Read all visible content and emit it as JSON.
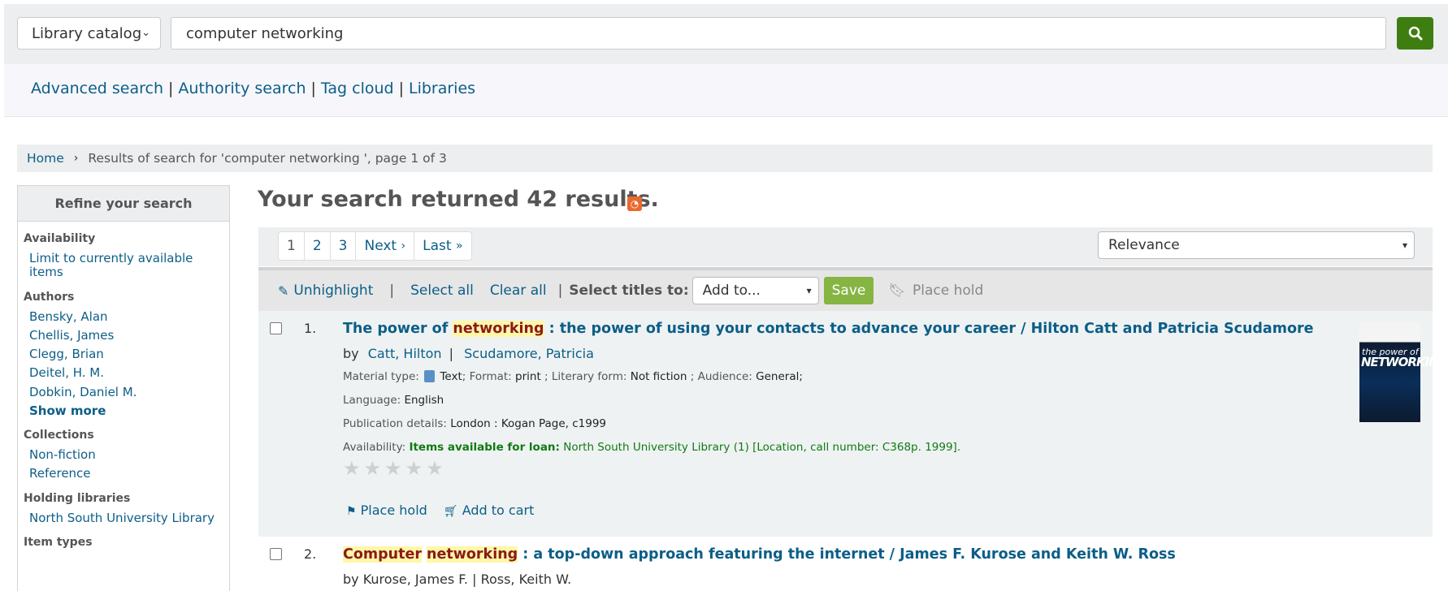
{
  "search": {
    "catalog_select": "Library catalog",
    "query": "computer networking"
  },
  "nav": {
    "links": [
      "Advanced search",
      "Authority search",
      "Tag cloud",
      "Libraries"
    ]
  },
  "breadcrumb": {
    "home": "Home",
    "current": "Results of search for 'computer networking ', page 1 of 3"
  },
  "refine": {
    "title": "Refine your search",
    "availability_label": "Availability",
    "availability_link": "Limit to currently available items",
    "authors_label": "Authors",
    "authors": [
      "Bensky, Alan",
      "Chellis, James",
      "Clegg, Brian",
      "Deitel, H. M.",
      "Dobkin, Daniel M."
    ],
    "show_more": "Show more",
    "collections_label": "Collections",
    "collections": [
      "Non-fiction",
      "Reference"
    ],
    "holding_label": "Holding libraries",
    "holding": [
      "North South University Library"
    ],
    "item_types_label": "Item types"
  },
  "results": {
    "heading": "Your search returned 42 results.",
    "pages": [
      "1",
      "2",
      "3"
    ],
    "next": "Next",
    "last": "Last",
    "sort": "Relevance"
  },
  "toolbar": {
    "unhighlight": "Unhighlight",
    "sep1": "|",
    "select_all": "Select all",
    "clear_all": "Clear all",
    "sep2": "|",
    "select_titles": "Select titles to:",
    "add_to": "Add to...",
    "save": "Save",
    "place_hold": "Place hold"
  },
  "result1": {
    "number": "1.",
    "title_pre": "The power of ",
    "title_hl": "networking",
    "title_post": " : the power of using your contacts to advance your career / Hilton Catt and Patricia Scudamore",
    "by": "by",
    "author1": "Catt, Hilton",
    "author2": "Scudamore, Patricia",
    "material_label": "Material type:",
    "material_value": "Text",
    "format_label": "; Format:",
    "format_value": "print",
    "literary_label": "; Literary form:",
    "literary_value": "Not fiction",
    "audience_label": "; Audience:",
    "audience_value": "General;",
    "language_label": "Language:",
    "language_value": "English",
    "pub_label": "Publication details:",
    "pub_value": "London : Kogan Page, c1999",
    "avail_label": "Availability:",
    "avail_bold": "Items available for loan:",
    "avail_value": "North South University Library (1) [Location, call number: C368p. 1999].",
    "place_hold": "Place hold",
    "add_cart": "Add to cart",
    "cover_small": "the power of",
    "cover_big": "NETWORKING"
  },
  "result2": {
    "number": "2.",
    "hl1": "Computer",
    "hl2": "networking",
    "title_post": " : a top-down approach featuring the internet / James F. Kurose and Keith W. Ross",
    "byline": "by Kurose, James F. | Ross, Keith W."
  }
}
